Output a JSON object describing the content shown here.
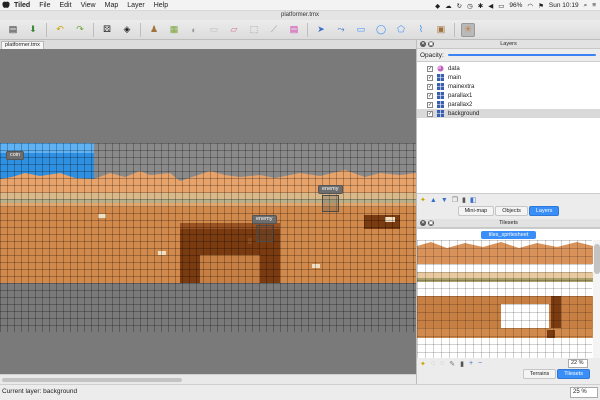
{
  "menubar": {
    "app_name": "Tiled",
    "items": [
      "File",
      "Edit",
      "View",
      "Map",
      "Layer",
      "Help"
    ],
    "battery": "96%",
    "clock": "Sun 10:19"
  },
  "window": {
    "title": "platformer.tmx"
  },
  "tabs": [
    {
      "label": "platformer.tmx"
    }
  ],
  "map_objects": [
    {
      "label": "coin"
    },
    {
      "label": "enemy"
    },
    {
      "label": "enemy"
    }
  ],
  "layers_panel": {
    "title": "Layers",
    "opacity_label": "Opacity:",
    "layers": [
      {
        "name": "data",
        "visible": true,
        "icon": "object-layer-icon"
      },
      {
        "name": "main",
        "visible": true,
        "icon": "tile-layer-icon"
      },
      {
        "name": "mainextra",
        "visible": true,
        "icon": "tile-layer-icon"
      },
      {
        "name": "parallax1",
        "visible": true,
        "icon": "tile-layer-icon"
      },
      {
        "name": "parallax2",
        "visible": true,
        "icon": "tile-layer-icon"
      },
      {
        "name": "background",
        "visible": true,
        "icon": "tile-layer-icon",
        "selected": true
      }
    ],
    "tabs": [
      "Mini-map",
      "Objects",
      "Layers"
    ],
    "active_tab": "Layers"
  },
  "tilesets_panel": {
    "title": "Tilesets",
    "tileset_tab": "tiles_spritesheet",
    "zoom": "22 %",
    "tabs": [
      "Terrains",
      "Tilesets"
    ],
    "active_tab": "Tilesets"
  },
  "status": {
    "current_layer": "Current layer: background",
    "zoom": "25 %"
  },
  "colors": {
    "accent": "#3a8ef7",
    "sky": "#2f8fe0",
    "sand": "#d99a5e",
    "dirt": "#c87f43",
    "dark_dirt": "#7a3b10",
    "canvas_bg": "#7a7a7a"
  }
}
